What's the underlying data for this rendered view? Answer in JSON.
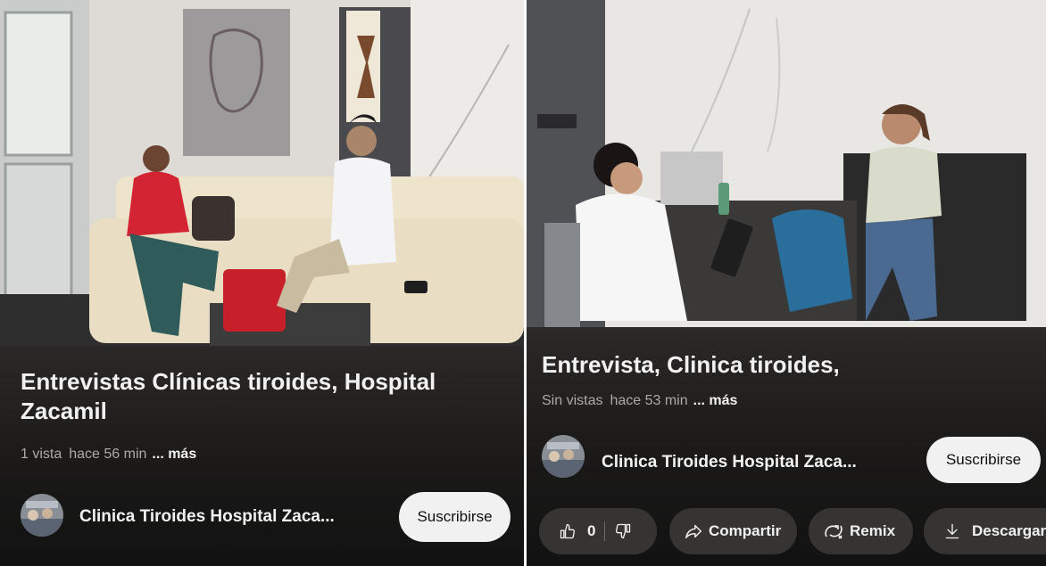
{
  "left_card": {
    "title": "Entrevistas Clínicas tiroides, Hospital Zacamil",
    "views": "1 vista",
    "time": "hace 56 min",
    "more": "... más",
    "channel_name": "Clinica Tiroides Hospital Zaca...",
    "subscribe_label": "Suscribirse"
  },
  "right_card": {
    "title": "Entrevista, Clinica tiroides,",
    "views": "Sin vistas",
    "time": "hace 53 min",
    "more": "... más",
    "channel_name": "Clinica Tiroides Hospital Zaca...",
    "subscribe_label": "Suscribirse",
    "actions": {
      "like_count": "0",
      "share_label": "Compartir",
      "remix_label": "Remix",
      "download_label": "Descargar"
    }
  },
  "icons": [
    "thumbs-up-icon",
    "thumbs-down-icon",
    "share-icon",
    "remix-icon",
    "download-icon"
  ],
  "colors": {
    "background": "#0f0f0f",
    "pill": "#353433",
    "subscribe_bg": "#f1f1f1",
    "meta_text": "#aaaaaa"
  }
}
